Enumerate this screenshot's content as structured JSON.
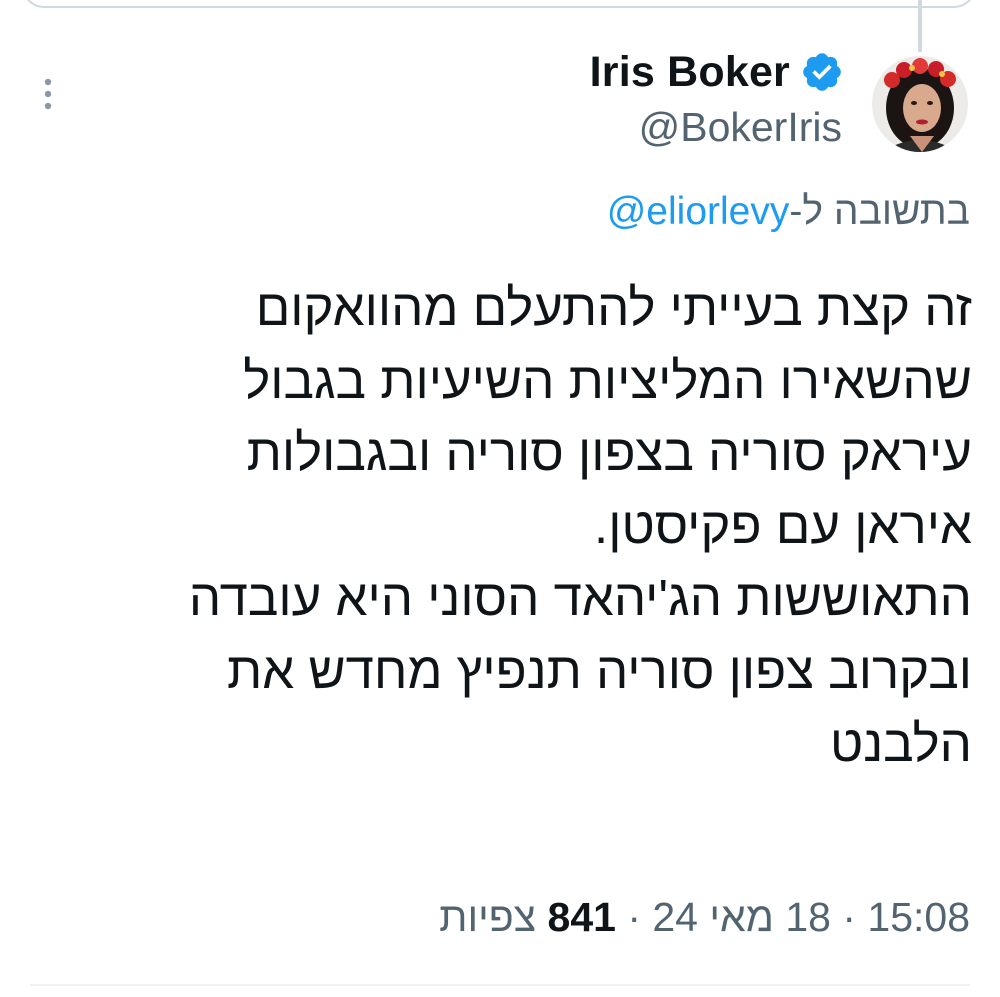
{
  "author": {
    "display_name": "Iris Boker",
    "handle": "@BokerIris",
    "verified_icon": "verified-badge-icon",
    "avatar_icon": "profile-photo"
  },
  "reply": {
    "prefix": "בתשובה ל-",
    "mention": "@eliorlevy"
  },
  "tweet": {
    "lines": [
      "זה קצת בעייתי להתעלם מהוואקום",
      "שהשאירו המליציות השיעיות בגבול",
      "עיראק סוריה בצפון סוריה ובגבולות",
      "איראן עם פקיסטן.",
      "התאוששות הג'יהאד הסוני היא עובדה",
      "ובקרוב צפון סוריה תנפיץ מחדש את",
      "הלבנט"
    ]
  },
  "meta": {
    "time": "15:08",
    "separator": " · ",
    "date": "18 מאי 24",
    "views_count": "841",
    "views_label": "צפיות"
  },
  "colors": {
    "primary_text": "#0f1419",
    "secondary_text": "#536471",
    "accent": "#1d9bf0",
    "border": "#cfd9de"
  },
  "icons": {
    "more": "more-options-icon"
  }
}
